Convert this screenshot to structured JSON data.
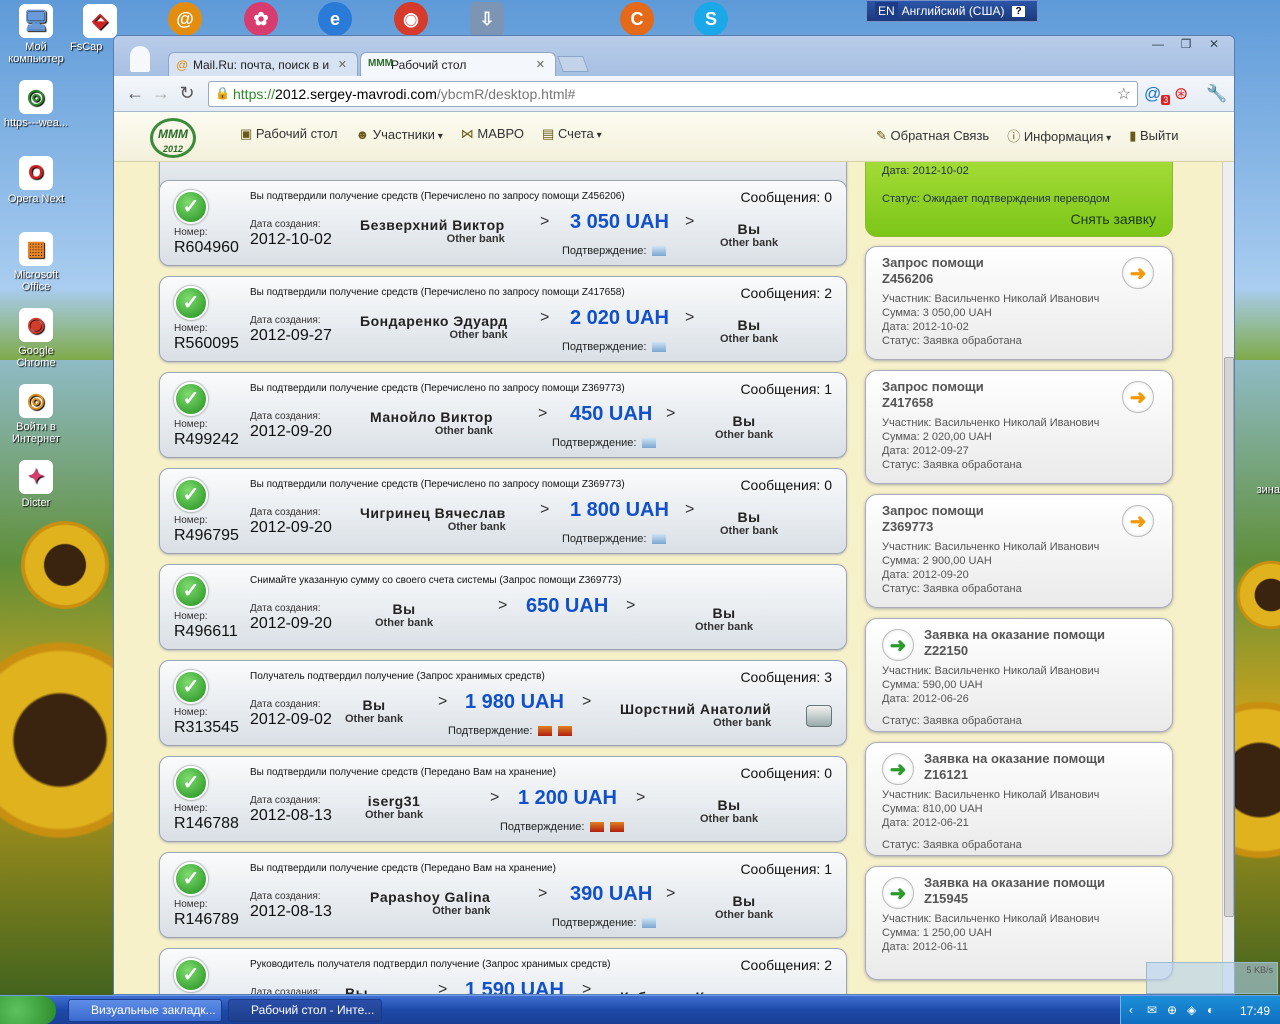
{
  "desktop": {
    "icons": [
      {
        "label": "Мой\nкомпьютер",
        "glyph": "🖥"
      },
      {
        "label": "https---wea...",
        "glyph": "◎"
      },
      {
        "label": "Opera Next",
        "glyph": "O"
      },
      {
        "label": "Microsoft\nOffice",
        "glyph": "▦"
      },
      {
        "label": "Google\nChrome",
        "glyph": "◉"
      },
      {
        "label": "Войти в\nИнтернет",
        "glyph": "◎"
      },
      {
        "label": "Dicter",
        "glyph": "✦"
      }
    ],
    "fscap_label": "FsCap",
    "right_label": "зина",
    "language_bar": {
      "code": "EN",
      "name": "Английский (США)",
      "help": "?"
    }
  },
  "browser": {
    "tabs": [
      {
        "title": "Mail.Ru: почта, поиск в инте",
        "active": false
      },
      {
        "title": "Рабочий стол",
        "active": true
      }
    ],
    "url": {
      "scheme": "https://",
      "host": "2012.sergey-mavrodi.com",
      "path": "/ybcmR/desktop.html#"
    },
    "ext_badge": "3"
  },
  "site": {
    "logo": {
      "line1": "МММ",
      "line2": "2012"
    },
    "menu": [
      {
        "label": "Рабочий стол",
        "icon": "desktop-icon",
        "dropdown": false
      },
      {
        "label": "Участники",
        "icon": "people-icon",
        "dropdown": true
      },
      {
        "label": "МАВРО",
        "icon": "mavro-icon",
        "dropdown": false
      },
      {
        "label": "Счета",
        "icon": "accounts-icon",
        "dropdown": true
      }
    ],
    "right_menu": [
      {
        "label": "Обратная Связь",
        "icon": "feedback-icon",
        "dropdown": false
      },
      {
        "label": "Информация",
        "icon": "info-icon",
        "dropdown": true
      },
      {
        "label": "Выйти",
        "icon": "exit-icon",
        "dropdown": false
      }
    ]
  },
  "labels": {
    "number": "Номер:",
    "created": "Дата создания:",
    "messages": "Сообщения:",
    "confirmation": "Подтверждение:",
    "other_bank": "Other bank",
    "you": "Вы",
    "participant": "Участник:",
    "sum": "Сумма:",
    "date": "Дата:",
    "status": "Статус:"
  },
  "transactions": [
    {
      "desc": "Вы подтвердили получение средств (Перечислено по запросу помощи Z456206)",
      "messages": "0",
      "number": "R604960",
      "date": "2012-10-02",
      "from": "Безверхний Виктор",
      "from_bank": "Other bank",
      "amount": "3 050 UAH",
      "to": "Вы",
      "to_bank": "Other bank",
      "confirm": "img"
    },
    {
      "desc": "Вы подтвердили получение средств (Перечислено по запросу помощи Z417658)",
      "messages": "2",
      "number": "R560095",
      "date": "2012-09-27",
      "from": "Бондаренко Эдуард",
      "from_bank": "Other bank",
      "amount": "2 020 UAH",
      "to": "Вы",
      "to_bank": "Other bank",
      "confirm": "img"
    },
    {
      "desc": "Вы подтвердили получение средств (Перечислено по запросу помощи Z369773)",
      "messages": "1",
      "number": "R499242",
      "date": "2012-09-20",
      "from": "Манойло Виктор",
      "from_bank": "Other bank",
      "amount": "450 UAH",
      "to": "Вы",
      "to_bank": "Other bank",
      "confirm": "img"
    },
    {
      "desc": "Вы подтвердили получение средств (Перечислено по запросу помощи Z369773)",
      "messages": "0",
      "number": "R496795",
      "date": "2012-09-20",
      "from": "Чигринец Вячеслав",
      "from_bank": "Other bank",
      "amount": "1 800 UAH",
      "to": "Вы",
      "to_bank": "Other bank",
      "confirm": "img"
    },
    {
      "desc": "Снимайте указанную сумму со своего счета системы (Запрос помощи Z369773)",
      "messages": "",
      "number": "R496611",
      "date": "2012-09-20",
      "from": "Вы",
      "from_bank": "Other bank",
      "amount": "650 UAH",
      "to": "Вы",
      "to_bank": "Other bank",
      "confirm": ""
    },
    {
      "desc": "Получатель подтвердил получение (Запрос хранимых средств)",
      "messages": "3",
      "number": "R313545",
      "date": "2012-09-02",
      "from": "Вы",
      "from_bank": "Other bank",
      "amount": "1 980 UAH",
      "to": "Шорстний Анатолий",
      "to_bank": "Other bank",
      "confirm": "two"
    },
    {
      "desc": "Вы подтвердили получение средств (Передано Вам на хранение)",
      "messages": "0",
      "number": "R146788",
      "date": "2012-08-13",
      "from": "iserg31",
      "from_bank": "Other bank",
      "amount": "1 200 UAH",
      "to": "Вы",
      "to_bank": "Other bank",
      "confirm": "two"
    },
    {
      "desc": "Вы подтвердили получение средств (Передано Вам на хранение)",
      "messages": "1",
      "number": "R146789",
      "date": "2012-08-13",
      "from": "Papashoy Galina",
      "from_bank": "Other bank",
      "amount": "390 UAH",
      "to": "Вы",
      "to_bank": "Other bank",
      "confirm": "img"
    },
    {
      "desc": "Руководитель получателя подтвердил получение (Запрос хранимых средств)",
      "messages": "2",
      "number": "",
      "date": "",
      "from": "Вы",
      "from_bank": "",
      "amount": "1 590 UAH",
      "to": "Кабардин Константин",
      "to_bank": "",
      "confirm": ""
    }
  ],
  "side_top": {
    "date_line": "Дата: 2012-10-02",
    "status_line": "Статус: Ожидает подтверждения переводом",
    "cancel": "Снять заявку"
  },
  "side_requests": [
    {
      "title": "Запрос помощи",
      "code": "Z456206",
      "participant": "Васильченко Николай Иванович",
      "sum": "3 050,00 UAH",
      "date": "2012-10-02",
      "status": "Заявка обработана",
      "kind": "orange"
    },
    {
      "title": "Запрос помощи",
      "code": "Z417658",
      "participant": "Васильченко Николай Иванович",
      "sum": "2 020,00 UAH",
      "date": "2012-09-27",
      "status": "Заявка обработана",
      "kind": "orange"
    },
    {
      "title": "Запрос помощи",
      "code": "Z369773",
      "participant": "Васильченко Николай Иванович",
      "sum": "2 900,00 UAH",
      "date": "2012-09-20",
      "status": "Заявка обработана",
      "kind": "orange"
    },
    {
      "title": "Заявка на оказание помощи",
      "code": "Z22150",
      "participant": "Васильченко Николай Иванович",
      "sum": "590,00 UAH",
      "date": "2012-06-26",
      "status": "Заявка обработана",
      "kind": "green"
    },
    {
      "title": "Заявка на оказание помощи",
      "code": "Z16121",
      "participant": "Васильченко Николай Иванович",
      "sum": "810,00 UAH",
      "date": "2012-06-21",
      "status": "Заявка обработана",
      "kind": "green"
    },
    {
      "title": "Заявка на оказание помощи",
      "code": "Z15945",
      "participant": "Васильченко Николай Иванович",
      "sum": "1 250,00 UAH",
      "date": "2012-06-11",
      "status": "",
      "kind": "green"
    }
  ],
  "taskbar": {
    "buttons": [
      "Визуальные закладк...",
      "Рабочий стол - Инте..."
    ],
    "clock": "17:49",
    "net_speed": "5 KB/s"
  }
}
